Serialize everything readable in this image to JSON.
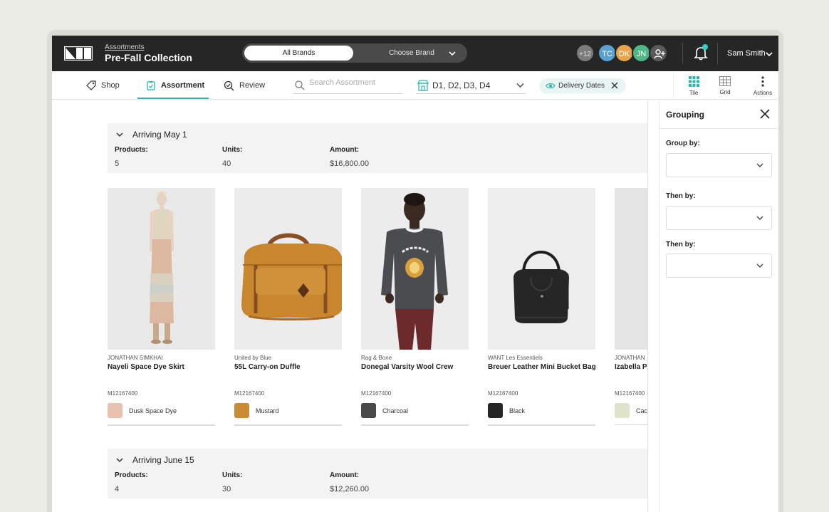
{
  "header": {
    "breadcrumb": "Assortments",
    "title": "Pre-Fall Collection",
    "brand_toggle": {
      "active": "All Brands",
      "inactive": "Choose Brand"
    },
    "avatars": {
      "more": "+12",
      "users": [
        "TC",
        "DK",
        "JN"
      ]
    },
    "user_name": "Sam Smith"
  },
  "toolbar": {
    "tabs": [
      "Shop",
      "Assortment",
      "Review"
    ],
    "search_placeholder": "Search Assortment",
    "stores_value": "D1, D2, D3, D4",
    "chip_label": "Delivery Dates",
    "views": [
      "Tile",
      "Grid",
      "Actions"
    ]
  },
  "groups": [
    {
      "title": "Arriving May 1",
      "products_label": "Products:",
      "products": "5",
      "units_label": "Units:",
      "units": "40",
      "amount_label": "Amount:",
      "amount": "$16,800.00"
    },
    {
      "title": "Arriving June 15",
      "products_label": "Products:",
      "products": "4",
      "units_label": "Units:",
      "units": "30",
      "amount_label": "Amount:",
      "amount": "$12,260.00"
    }
  ],
  "products": [
    {
      "brand": "JONATHAN SIMKHAI",
      "name": "Nayeli Space Dye Skirt",
      "sku": "M12167400",
      "color": "Dusk Space Dye",
      "swatch": "#e7c2b0"
    },
    {
      "brand": "United by Blue",
      "name": "55L Carry-on Duffle",
      "sku": "M12167400",
      "color": "Mustard",
      "swatch": "#c98a35"
    },
    {
      "brand": "Rag & Bone",
      "name": "Donegal Varsity Wool Crew",
      "sku": "M12167400",
      "color": "Charcoal",
      "swatch": "#4a4a4a"
    },
    {
      "brand": "WANT Les Essentiels",
      "name": "Breuer Leather Mini Bucket Bag",
      "sku": "M12167400",
      "color": "Black",
      "swatch": "#262626"
    },
    {
      "brand": "JONATHAN",
      "name": "Izabella Pr",
      "sku": "M12167400",
      "color": "Cac",
      "swatch": "#dfe3c9"
    }
  ],
  "grouping_panel": {
    "title": "Grouping",
    "labels": [
      "Group by:",
      "Then by:",
      "Then by:"
    ]
  },
  "colors": {
    "accent": "#2bb7ad",
    "header_bg": "#262626",
    "notification": "#2fd0c4"
  }
}
